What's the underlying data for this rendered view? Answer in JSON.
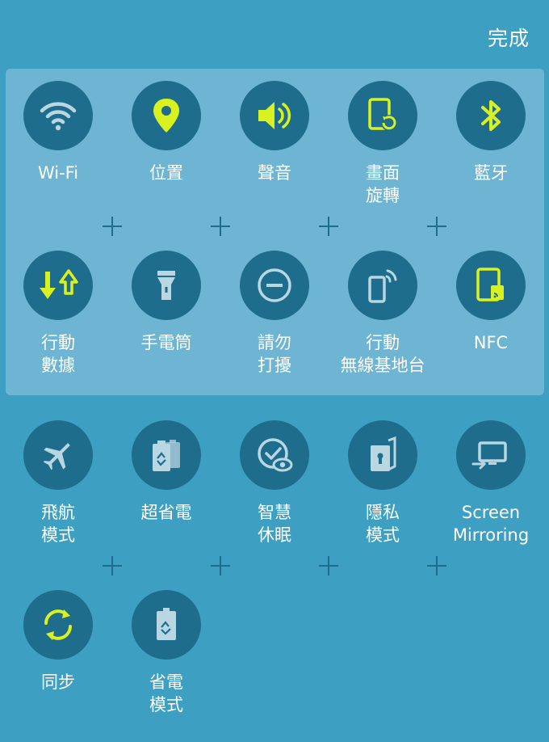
{
  "header": {
    "done_label": "完成"
  },
  "colors": {
    "background": "#3d9fc1",
    "active_panel": "#6db5d2",
    "icon_circle": "#1f6d8c",
    "active_icon": "#d9f21f",
    "inactive_icon": "#b8d7e3",
    "label": "#ffffff"
  },
  "active_tiles": [
    {
      "label": "Wi-Fi",
      "icon": "wifi-icon",
      "on": true
    },
    {
      "label": "位置",
      "icon": "location-pin-icon",
      "on": true
    },
    {
      "label": "聲音",
      "icon": "speaker-icon",
      "on": true
    },
    {
      "label": "畫面\n旋轉",
      "icon": "screen-rotation-icon",
      "on": true
    },
    {
      "label": "藍牙",
      "icon": "bluetooth-icon",
      "on": true
    },
    {
      "label": "行動\n數據",
      "icon": "mobile-data-icon",
      "on": true
    },
    {
      "label": "手電筒",
      "icon": "flashlight-icon",
      "on": false
    },
    {
      "label": "請勿\n打擾",
      "icon": "do-not-disturb-icon",
      "on": false
    },
    {
      "label": "行動\n無線基地台",
      "icon": "mobile-hotspot-icon",
      "on": false
    },
    {
      "label": "NFC",
      "icon": "nfc-icon",
      "on": true
    }
  ],
  "available_tiles": [
    {
      "label": "飛航\n模式",
      "icon": "airplane-icon",
      "on": false
    },
    {
      "label": "超省電",
      "icon": "ultra-power-saving-icon",
      "on": false
    },
    {
      "label": "智慧\n休眠",
      "icon": "smart-stay-icon",
      "on": false
    },
    {
      "label": "隱私\n模式",
      "icon": "private-mode-icon",
      "on": false
    },
    {
      "label": "Screen\nMirroring",
      "icon": "screen-mirroring-icon",
      "on": false
    },
    {
      "label": "同步",
      "icon": "sync-icon",
      "on": true
    },
    {
      "label": "省電\n模式",
      "icon": "power-saving-icon",
      "on": false
    }
  ]
}
